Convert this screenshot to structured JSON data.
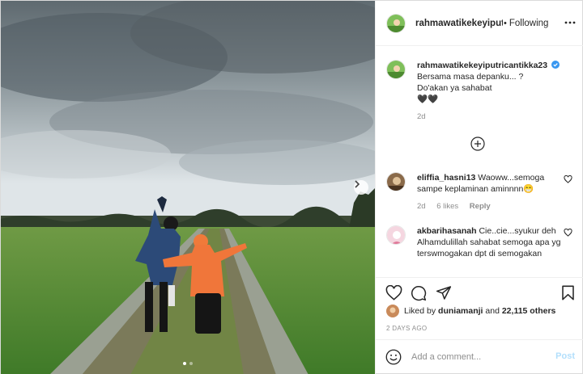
{
  "post": {
    "author": "rahmawatikekeyiputricantikka23",
    "follow_status": "Following",
    "caption_lines": [
      "Bersama masa depanku... ?",
      "Do'akan ya sahabat",
      "🖤🖤"
    ],
    "caption_time": "2d"
  },
  "comments": [
    {
      "username": "eliffia_hasni13",
      "text": "Waoww...semoga sampe keplaminan aminnnn😁",
      "time": "2d",
      "likes": "6 likes",
      "reply": "Reply"
    },
    {
      "username": "akbarihasanah",
      "text": "Cie..cie...syukur deh Alhamdulillah sahabat semoga apa yg terswmogakan dpt di semogakan"
    }
  ],
  "likes": {
    "prefix": "Liked by",
    "user": "duniamanji",
    "and": "and",
    "count": "22,115 others"
  },
  "timestamp": "2 DAYS AGO",
  "add_comment": {
    "placeholder": "Add a comment...",
    "post_label": "Post"
  },
  "colors": {
    "verified": "#3897f0",
    "post_disabled": "#b2dffc",
    "meta": "#8e8e8e"
  }
}
